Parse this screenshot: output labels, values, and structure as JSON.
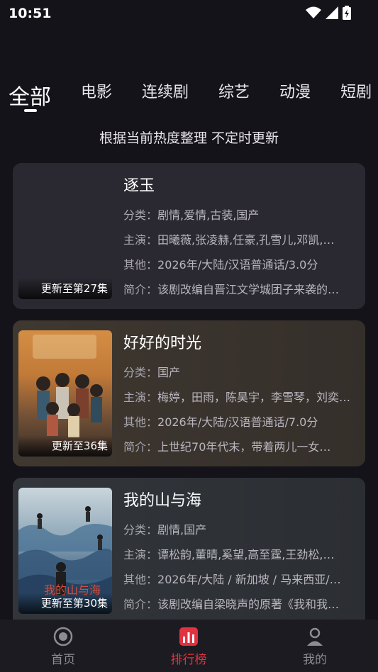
{
  "status": {
    "time": "10:51"
  },
  "tabs": [
    {
      "label": "全部",
      "active": true
    },
    {
      "label": "电影",
      "active": false
    },
    {
      "label": "连续剧",
      "active": false
    },
    {
      "label": "综艺",
      "active": false
    },
    {
      "label": "动漫",
      "active": false
    },
    {
      "label": "短剧",
      "active": false
    }
  ],
  "subtitle": "根据当前热度整理 不定时更新",
  "cards": [
    {
      "title": "逐玉",
      "badge": "更新至第27集",
      "category_key": "分类：",
      "category": "剧情,爱情,古装,国产",
      "cast_key": "主演：",
      "cast": "田曦薇,张凌赫,任豪,孔雪儿,邓凯,…",
      "other_key": "其他：",
      "other": "2026年/大陆/汉语普通话/3.0分",
      "intro_key": "简介：",
      "intro": "该剧改编自晋江文学城团子来袭的…",
      "bg": "#2a2830"
    },
    {
      "title": "好好的时光",
      "badge": "更新至36集",
      "category_key": "分类：",
      "category": "国产",
      "cast_key": "主演：",
      "cast": "梅婷，田雨，陈昊宇，李雪琴，刘奕…",
      "other_key": "其他：",
      "other": "2026年/大陆/汉语普通话/7.0分",
      "intro_key": "简介：",
      "intro": "上世纪70年代末，带着两儿一女…",
      "bg": "#3d3630"
    },
    {
      "title": "我的山与海",
      "badge": "更新至第30集",
      "category_key": "分类：",
      "category": "剧情,国产",
      "cast_key": "主演：",
      "cast": "谭松韵,董晴,奚望,高至霆,王劲松,…",
      "other_key": "其他：",
      "other": "2026年/大陆 / 新加坡 / 马来西亚/…",
      "intro_key": "简介：",
      "intro": "该剧改编自梁晓声的原著《我和我…",
      "bg": "#2f3236"
    }
  ],
  "nav": [
    {
      "label": "首页",
      "icon": "home-icon",
      "active": false
    },
    {
      "label": "排行榜",
      "icon": "ranking-icon",
      "active": true
    },
    {
      "label": "我的",
      "icon": "profile-icon",
      "active": false
    }
  ],
  "colors": {
    "accent": "#e2323f",
    "background": "#15131a"
  }
}
